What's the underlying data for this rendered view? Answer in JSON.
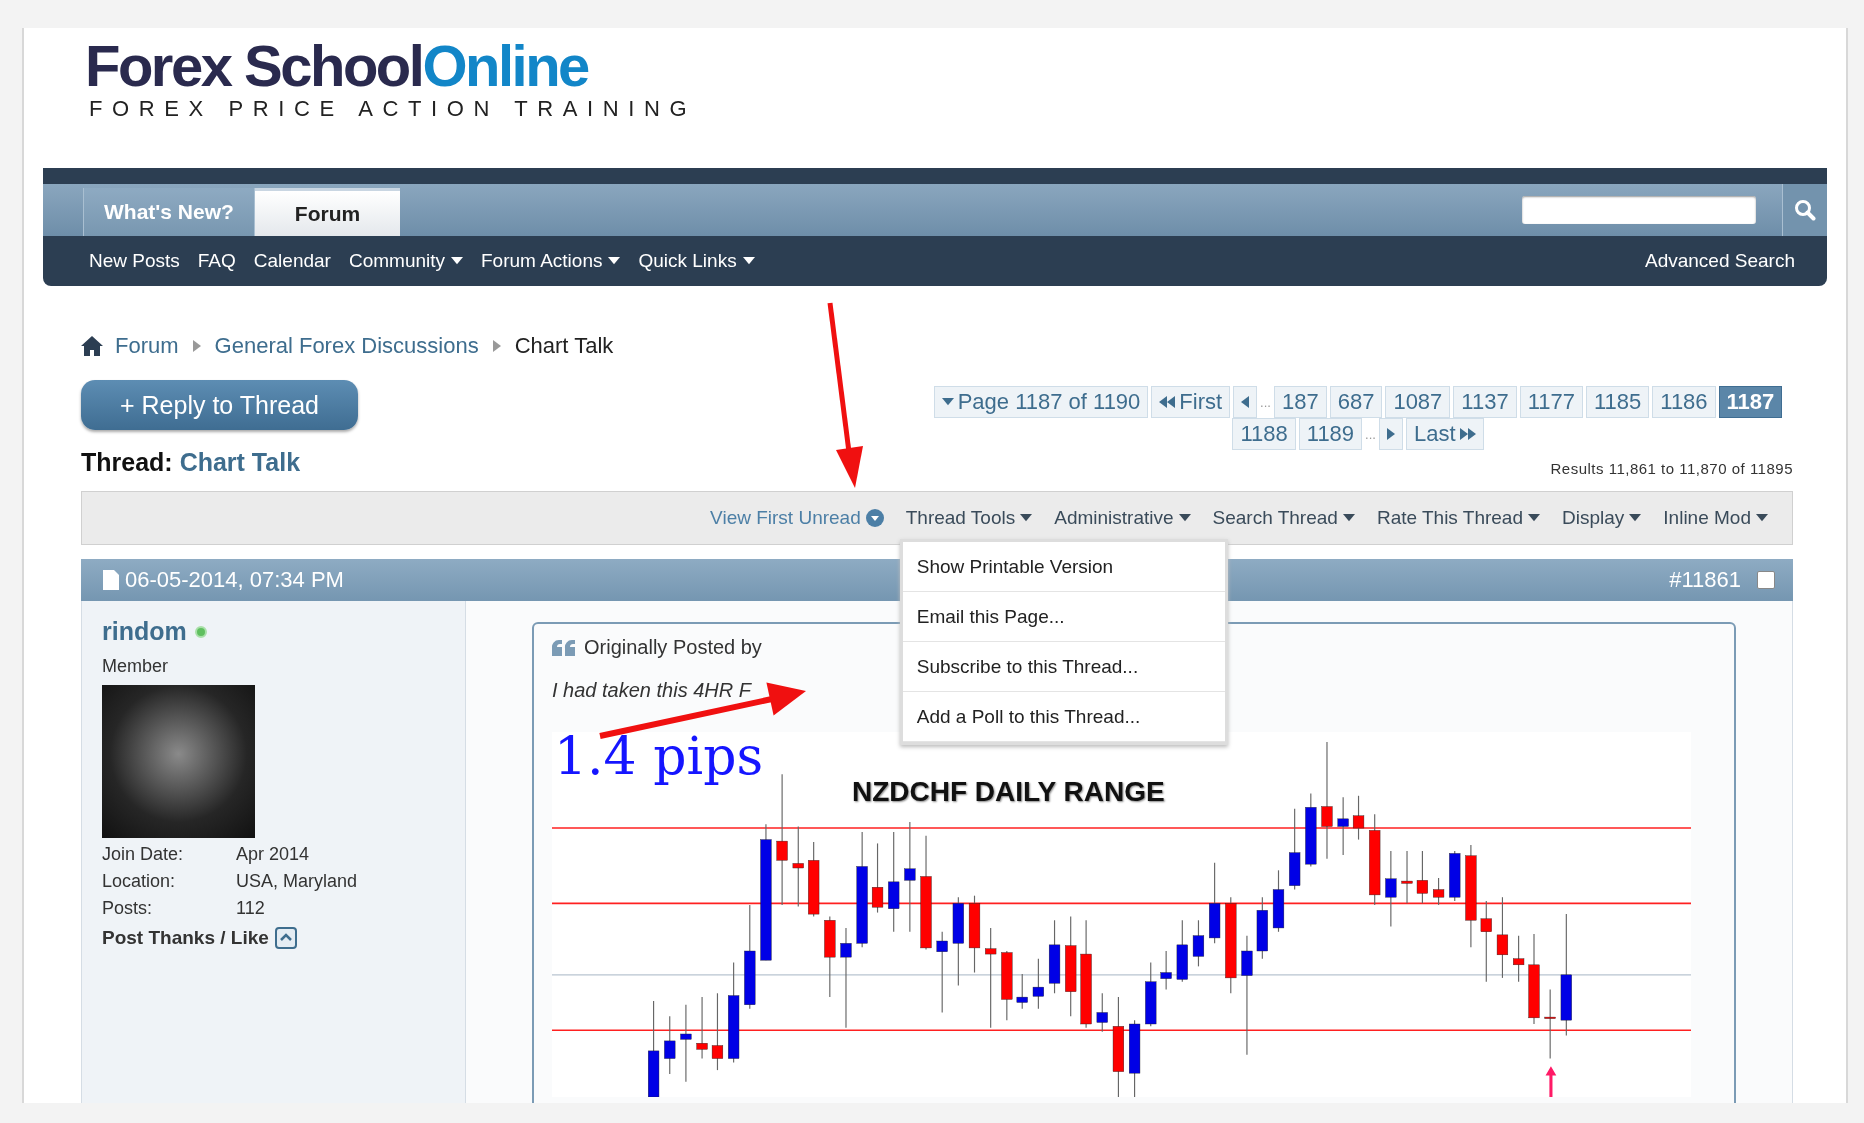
{
  "logo": {
    "name_dark": "Forex School",
    "name_light": "Online",
    "tagline": "FOREX PRICE ACTION TRAINING"
  },
  "nav": {
    "tabs": [
      {
        "label": "What's New?",
        "selected": false
      },
      {
        "label": "Forum",
        "selected": true
      }
    ],
    "links": [
      {
        "label": "New Posts",
        "dropdown": false
      },
      {
        "label": "FAQ",
        "dropdown": false
      },
      {
        "label": "Calendar",
        "dropdown": false
      },
      {
        "label": "Community",
        "dropdown": true
      },
      {
        "label": "Forum Actions",
        "dropdown": true
      },
      {
        "label": "Quick Links",
        "dropdown": true
      }
    ],
    "advanced_search": "Advanced Search"
  },
  "breadcrumb": [
    {
      "label": "Forum",
      "current": false
    },
    {
      "label": "General Forex Discussions",
      "current": false
    },
    {
      "label": "Chart Talk",
      "current": true
    }
  ],
  "reply_button": "+ Reply to Thread",
  "pagination": {
    "items": [
      {
        "kind": "jump",
        "label": "Page 1187 of 1190"
      },
      {
        "kind": "first",
        "label": "First"
      },
      {
        "kind": "prev"
      },
      {
        "kind": "ellipsis",
        "label": "..."
      },
      {
        "kind": "page",
        "label": "187",
        "selected": false
      },
      {
        "kind": "page",
        "label": "687",
        "selected": false
      },
      {
        "kind": "page",
        "label": "1087",
        "selected": false
      },
      {
        "kind": "page",
        "label": "1137",
        "selected": false
      },
      {
        "kind": "page",
        "label": "1177",
        "selected": false
      },
      {
        "kind": "page",
        "label": "1185",
        "selected": false
      },
      {
        "kind": "page",
        "label": "1186",
        "selected": false
      },
      {
        "kind": "page",
        "label": "1187",
        "selected": true
      },
      {
        "kind": "page",
        "label": "1188",
        "selected": false
      },
      {
        "kind": "page",
        "label": "1189",
        "selected": false
      },
      {
        "kind": "ellipsis",
        "label": "..."
      },
      {
        "kind": "next"
      },
      {
        "kind": "last",
        "label": "Last"
      }
    ]
  },
  "results": "Results 11,861 to 11,870 of 11895",
  "thread": {
    "label": "Thread:",
    "title": "Chart Talk"
  },
  "toolbar": [
    {
      "kind": "link",
      "label": "View First Unread"
    },
    {
      "kind": "menu",
      "label": "Thread Tools",
      "menu": [
        "Show Printable Version",
        "Email this Page...",
        "Subscribe to this Thread...",
        "Add a Poll to this Thread..."
      ]
    },
    {
      "kind": "menu",
      "label": "Administrative"
    },
    {
      "kind": "menu",
      "label": "Search Thread"
    },
    {
      "kind": "menu",
      "label": "Rate This Thread"
    },
    {
      "kind": "menu",
      "label": "Display"
    },
    {
      "kind": "menu",
      "label": "Inline Mod"
    }
  ],
  "post": {
    "date": "06-05-2014, 07:34 PM",
    "number": "#11861",
    "checked": false,
    "user": {
      "name": "rindom",
      "online": true,
      "title": "Member",
      "info": [
        {
          "label": "Join Date:",
          "value": "Apr 2014"
        },
        {
          "label": "Location:",
          "value": "USA, Maryland"
        },
        {
          "label": "Posts:",
          "value": "112"
        }
      ],
      "thanks": "Post Thanks / Like"
    },
    "quote": {
      "header": "Originally Posted by",
      "text": "I had taken this 4HR F"
    },
    "chart": {
      "note": "1.4 pips",
      "title": "NZDCHF DAILY RANGE"
    }
  }
}
